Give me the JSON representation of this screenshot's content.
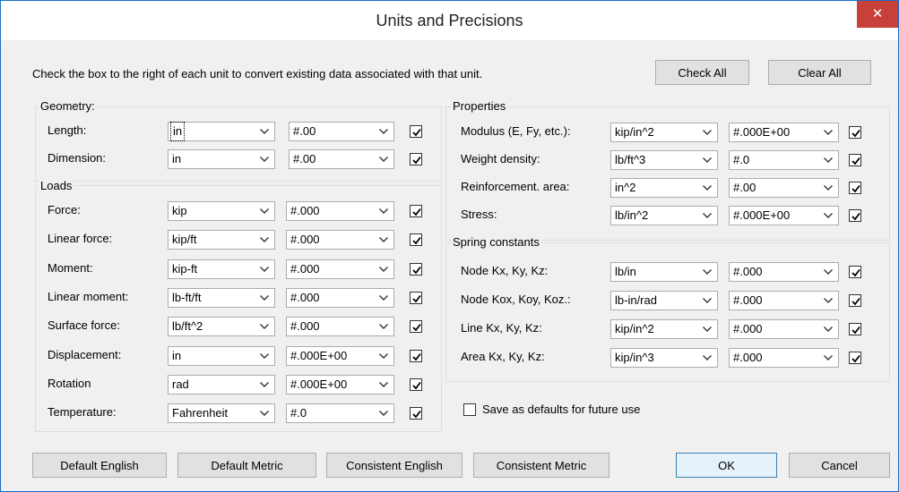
{
  "window": {
    "title": "Units and Precisions",
    "close_icon": "close-icon",
    "accent": "#c7403a"
  },
  "instruction": "Check the box to the right of each unit to convert existing data associated with that unit.",
  "top_buttons": {
    "check_all": "Check All",
    "clear_all": "Clear All"
  },
  "geometry": {
    "label": "Geometry:",
    "rows": [
      {
        "label": "Length:",
        "unit": "in",
        "precision": "#.00",
        "checked": true
      },
      {
        "label": "Dimension:",
        "unit": "in",
        "precision": "#.00",
        "checked": true
      }
    ]
  },
  "loads": {
    "label": "Loads",
    "rows": [
      {
        "label": "Force:",
        "unit": "kip",
        "precision": "#.000",
        "checked": true
      },
      {
        "label": "Linear force:",
        "unit": "kip/ft",
        "precision": "#.000",
        "checked": true
      },
      {
        "label": "Moment:",
        "unit": "kip-ft",
        "precision": "#.000",
        "checked": true
      },
      {
        "label": "Linear moment:",
        "unit": "lb-ft/ft",
        "precision": "#.000",
        "checked": true
      },
      {
        "label": "Surface force:",
        "unit": "lb/ft^2",
        "precision": "#.000",
        "checked": true
      },
      {
        "label": "Displacement:",
        "unit": "in",
        "precision": "#.000E+00",
        "checked": true
      },
      {
        "label": "Rotation",
        "unit": "rad",
        "precision": "#.000E+00",
        "checked": true
      },
      {
        "label": "Temperature:",
        "unit": "Fahrenheit",
        "precision": "#.0",
        "checked": true
      }
    ]
  },
  "properties": {
    "label": "Properties",
    "rows": [
      {
        "label": "Modulus (E, Fy, etc.):",
        "unit": "kip/in^2",
        "precision": "#.000E+00",
        "checked": true
      },
      {
        "label": "Weight density:",
        "unit": "lb/ft^3",
        "precision": "#.0",
        "checked": true
      },
      {
        "label": "Reinforcement. area:",
        "unit": "in^2",
        "precision": "#.00",
        "checked": true
      },
      {
        "label": "Stress:",
        "unit": "lb/in^2",
        "precision": "#.000E+00",
        "checked": true
      }
    ]
  },
  "springs": {
    "label": "Spring constants",
    "rows": [
      {
        "label": "Node Kx, Ky, Kz:",
        "unit": "lb/in",
        "precision": "#.000",
        "checked": true
      },
      {
        "label": "Node Kox, Koy, Koz.:",
        "unit": "lb-in/rad",
        "precision": "#.000",
        "checked": true
      },
      {
        "label": "Line Kx, Ky, Kz:",
        "unit": "kip/in^2",
        "precision": "#.000",
        "checked": true
      },
      {
        "label": "Area Kx, Ky, Kz:",
        "unit": "kip/in^3",
        "precision": "#.000",
        "checked": true
      }
    ]
  },
  "save_defaults": {
    "label": "Save as defaults for future use",
    "checked": false
  },
  "bottom_buttons": {
    "default_english": "Default English",
    "default_metric": "Default Metric",
    "consistent_english": "Consistent English",
    "consistent_metric": "Consistent Metric",
    "ok": "OK",
    "cancel": "Cancel"
  }
}
